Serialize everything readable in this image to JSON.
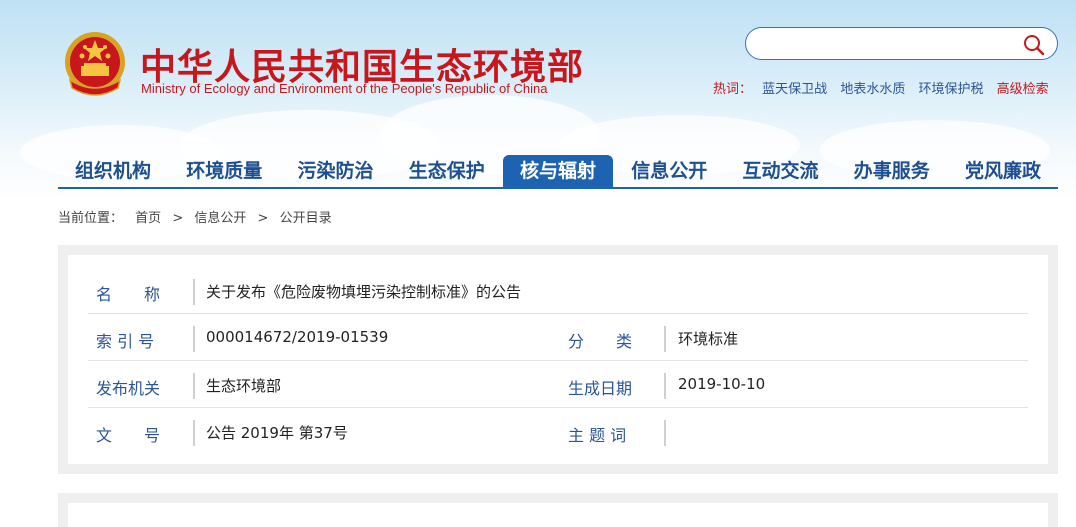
{
  "header": {
    "title_cn": "中华人民共和国生态环境部",
    "title_en": "Ministry of Ecology and Environment of the People's Republic of China",
    "emblem": "national-emblem-icon"
  },
  "search": {
    "placeholder": "",
    "value": "",
    "icon": "search-icon"
  },
  "hotwords": {
    "label": "热词：",
    "items": [
      "蓝天保卫战",
      "地表水水质",
      "环境保护税"
    ],
    "advanced": "高级检索"
  },
  "nav": {
    "items": [
      "组织机构",
      "环境质量",
      "污染防治",
      "生态保护",
      "核与辐射",
      "信息公开",
      "互动交流",
      "办事服务",
      "党风廉政"
    ],
    "active_index": 4
  },
  "breadcrumb": {
    "label": "当前位置：",
    "items": [
      "首页",
      "信息公开",
      "公开目录"
    ],
    "separator": ">"
  },
  "info": {
    "name_label": "名　　称",
    "name_value": "关于发布《危险废物填埋污染控制标准》的公告",
    "index_label": "索 引 号",
    "index_value": "000014672/2019-01539",
    "category_label": "分　　类",
    "category_value": "环境标准",
    "issuer_label": "发布机关",
    "issuer_value": "生态环境部",
    "date_label": "生成日期",
    "date_value": "2019-10-10",
    "docno_label": "文　　号",
    "docno_value": "公告 2019年 第37号",
    "subject_label": "主 题 词",
    "subject_value": ""
  },
  "colors": {
    "brand_red": "#c8161d",
    "nav_blue": "#1d63b1",
    "label_blue": "#2b5596"
  }
}
